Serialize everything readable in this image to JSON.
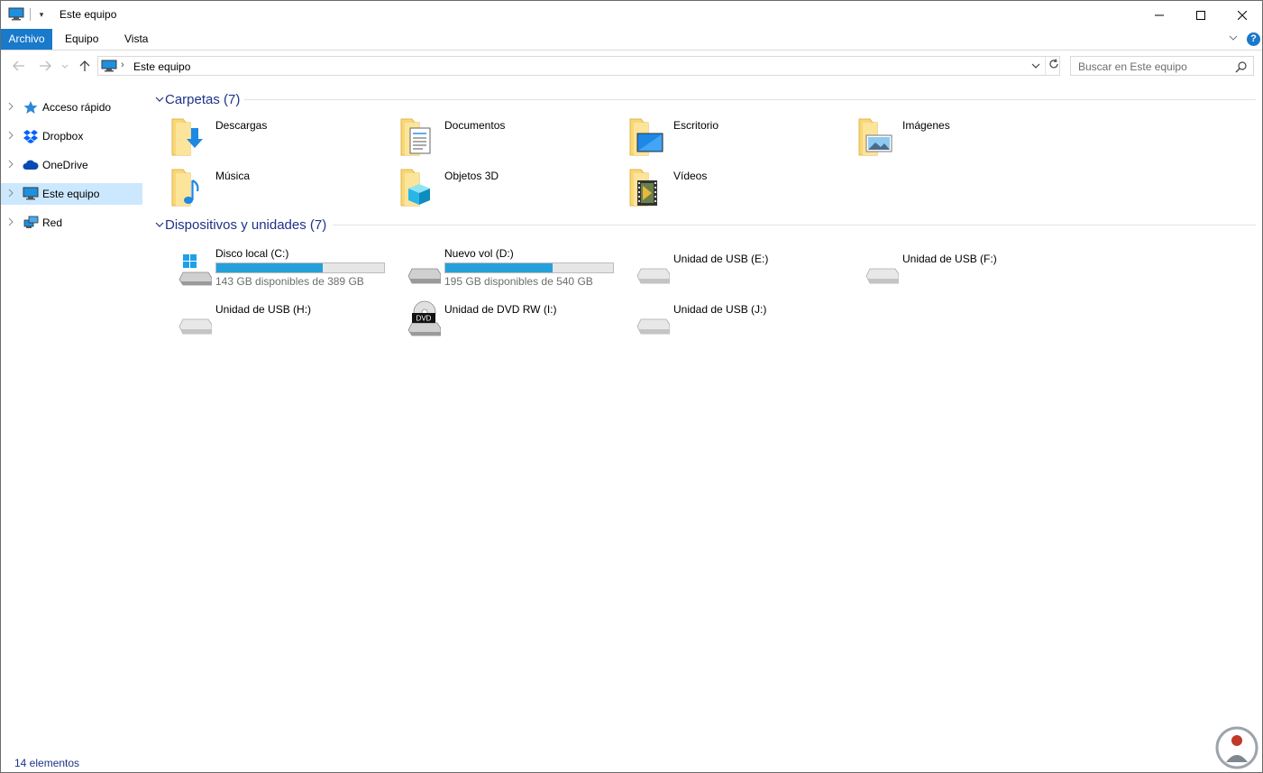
{
  "window": {
    "title": "Este equipo",
    "qa_dropdown": "▾"
  },
  "ribbon": {
    "tabs": [
      {
        "label": "Archivo"
      },
      {
        "label": "Equipo"
      },
      {
        "label": "Vista"
      }
    ],
    "help": "?"
  },
  "nav": {
    "breadcrumb_separator": "›",
    "address": "Este equipo",
    "search_placeholder": "Buscar en Este equipo"
  },
  "sidebar": {
    "items": [
      {
        "label": "Acceso rápido",
        "icon": "star-icon"
      },
      {
        "label": "Dropbox",
        "icon": "dropbox-icon"
      },
      {
        "label": "OneDrive",
        "icon": "cloud-icon"
      },
      {
        "label": "Este equipo",
        "icon": "computer-icon",
        "selected": true
      },
      {
        "label": "Red",
        "icon": "network-icon"
      }
    ]
  },
  "groups": {
    "folders": {
      "title": "Carpetas (7)",
      "items": [
        {
          "label": "Descargas",
          "icon": "downloads-folder-icon"
        },
        {
          "label": "Documentos",
          "icon": "documents-folder-icon"
        },
        {
          "label": "Escritorio",
          "icon": "desktop-folder-icon"
        },
        {
          "label": "Imágenes",
          "icon": "pictures-folder-icon"
        },
        {
          "label": "Música",
          "icon": "music-folder-icon"
        },
        {
          "label": "Objetos 3D",
          "icon": "3d-objects-folder-icon"
        },
        {
          "label": "Vídeos",
          "icon": "videos-folder-icon"
        }
      ]
    },
    "drives": {
      "title": "Dispositivos y unidades (7)",
      "items": [
        {
          "label": "Disco local (C:)",
          "icon": "windows-drive-icon",
          "free": "143 GB disponibles de 389 GB",
          "used_fraction": 0.632
        },
        {
          "label": "Nuevo vol (D:)",
          "icon": "hard-drive-icon",
          "free": "195 GB disponibles de 540 GB",
          "used_fraction": 0.639
        },
        {
          "label": "Unidad de USB (E:)",
          "icon": "usb-drive-icon"
        },
        {
          "label": "Unidad de USB (F:)",
          "icon": "usb-drive-icon"
        },
        {
          "label": "Unidad de USB (H:)",
          "icon": "usb-drive-icon"
        },
        {
          "label": "Unidad de DVD RW (I:)",
          "icon": "dvd-drive-icon",
          "badge": "DVD"
        },
        {
          "label": "Unidad de USB (J:)",
          "icon": "usb-drive-icon"
        }
      ]
    }
  },
  "status": {
    "count": "14 elementos"
  },
  "colors": {
    "accent": "#1979ca",
    "selection": "#cce8ff",
    "group_title": "#1e3287",
    "drive_fill": "#26a0da",
    "folder": "#f8d775"
  }
}
